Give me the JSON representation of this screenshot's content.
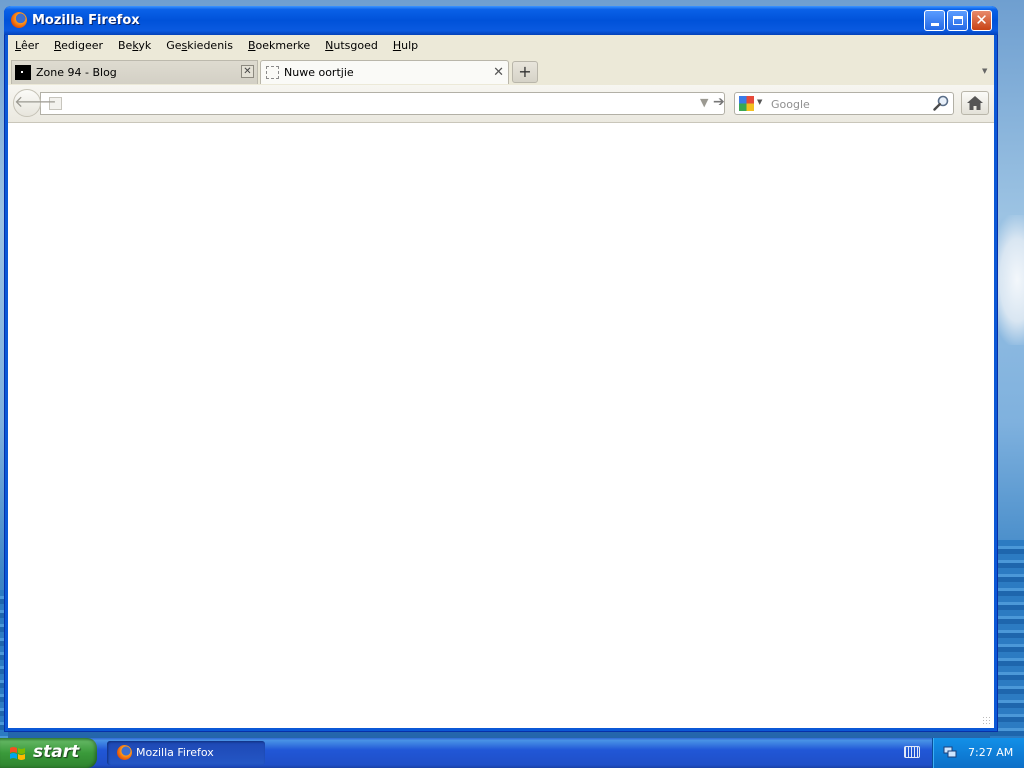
{
  "window": {
    "title": "Mozilla Firefox",
    "controls": {
      "minimize": "minimize",
      "maximize": "maximize",
      "close": "close"
    }
  },
  "menubar": {
    "items": [
      {
        "label": "Lêer",
        "accel": "L"
      },
      {
        "label": "Redigeer",
        "accel": "R"
      },
      {
        "label": "Bekyk",
        "accel": "k"
      },
      {
        "label": "Geskiedenis",
        "accel": "s"
      },
      {
        "label": "Boekmerke",
        "accel": "B"
      },
      {
        "label": "Nutsgoed",
        "accel": "N"
      },
      {
        "label": "Hulp",
        "accel": "H"
      }
    ]
  },
  "tabs": [
    {
      "label": "Zone 94 - Blog",
      "active": false,
      "close": "✕"
    },
    {
      "label": "Nuwe oortjie",
      "active": true,
      "close": "✕"
    }
  ],
  "newtab_label": "+",
  "navbar": {
    "url_value": "",
    "url_placeholder": "",
    "search_engine": "Google",
    "search_placeholder": "Google"
  },
  "taskbar": {
    "start_label": "start",
    "task_label": "Mozilla Firefox",
    "clock": "7:27 AM"
  },
  "colors": {
    "titlebar": "#0052d9",
    "chrome": "#ece9d8",
    "start": "#3a9a3a",
    "tray": "#0f7fd8"
  }
}
